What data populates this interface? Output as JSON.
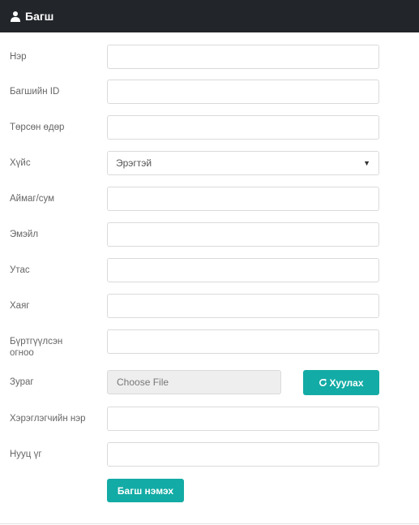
{
  "header": {
    "title": "Багш",
    "icon": "user-icon"
  },
  "form": {
    "fields": [
      {
        "label": "Нэр",
        "value": ""
      },
      {
        "label": "Багшийн ID",
        "value": ""
      },
      {
        "label": "Төрсөн өдөр",
        "value": ""
      },
      {
        "label": "Хүйс",
        "value": "Эрэгтэй"
      },
      {
        "label": "Аймаг/сум",
        "value": ""
      },
      {
        "label": "Эмэйл",
        "value": ""
      },
      {
        "label": "Утас",
        "value": ""
      },
      {
        "label": "Хаяг",
        "value": ""
      },
      {
        "label_line1": "Бүртгүүлсэн",
        "label_line2": "огноо",
        "value": ""
      },
      {
        "label": "Зураг",
        "file_label": "Choose File"
      },
      {
        "label": "Хэрэглэгчийн нэр",
        "value": ""
      },
      {
        "label": "Нууц үг",
        "value": ""
      }
    ],
    "reset_label": "Хуулах",
    "reset_icon": "refresh-icon",
    "submit_label": "Багш нэмэх"
  },
  "colors": {
    "header_bg": "#22262b",
    "accent": "#13aba5"
  }
}
